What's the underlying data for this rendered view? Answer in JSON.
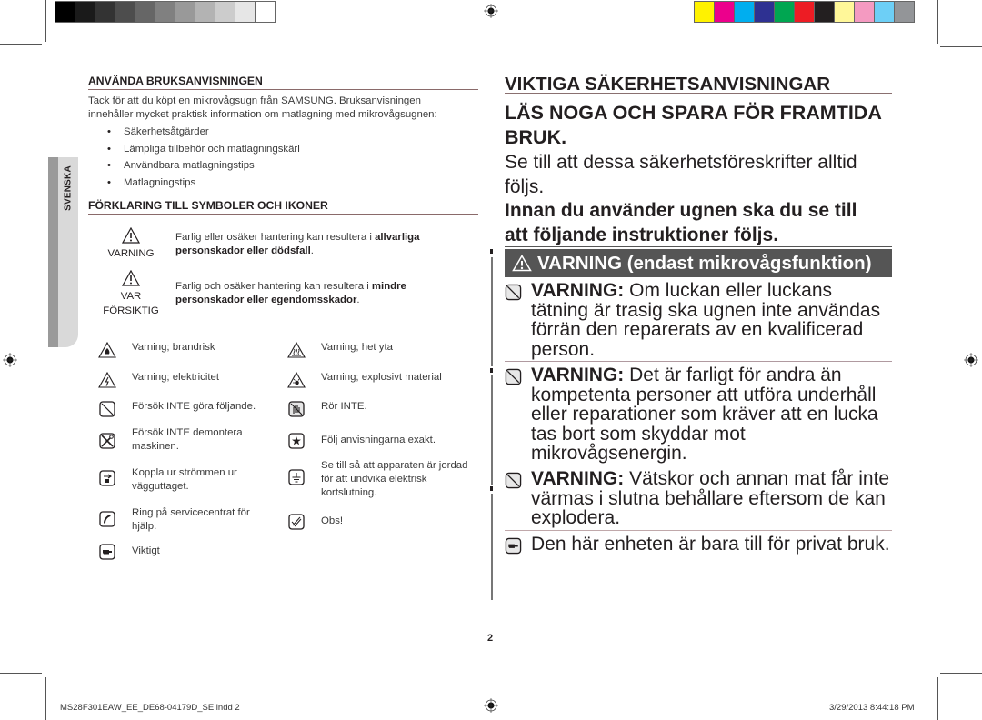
{
  "print_marks": {
    "grayscale_swatches": [
      "#000000",
      "#1a1a1a",
      "#333333",
      "#4d4d4d",
      "#666666",
      "#808080",
      "#999999",
      "#b3b3b3",
      "#cccccc",
      "#e6e6e6",
      "#ffffff"
    ],
    "color_swatches": [
      "#fff200",
      "#ec008c",
      "#00aeef",
      "#2e3192",
      "#00a651",
      "#ed1c24",
      "#231f20",
      "#fff799",
      "#f49ac1",
      "#6dcff6",
      "#939598"
    ]
  },
  "language_tab": "SVENSKA",
  "left": {
    "section1": {
      "heading": "ANVÄNDA BRUKSANVISNINGEN",
      "intro_line1": "Tack för att du köpt en mikrovågsugn från SAMSUNG. Bruksanvisningen",
      "intro_line2": "innehåller mycket praktisk information om matlagning med mikrovågsugnen:",
      "bullets": [
        "Säkerhetsåtgärder",
        "Lämpliga tillbehör och matlagningskärl",
        "Användbara matlagningstips",
        "Matlagningstips"
      ]
    },
    "section2": {
      "heading": "FÖRKLARING TILL SYMBOLER OCH IKONER",
      "warning": {
        "label": "VARNING",
        "text_prefix": "Farlig eller osäker hantering kan resultera i ",
        "bold1": "allvarliga",
        "bold2": "personskador eller dödsfall",
        "suffix": "."
      },
      "caution": {
        "label1": "VAR",
        "label2": "FÖRSIKTIG",
        "text_prefix": "Farlig och osäker hantering kan resultera i ",
        "bold1": "mindre",
        "bold2": "personskador eller egendomsskador",
        "suffix": "."
      },
      "symbols": [
        {
          "icon": "fire-hazard-icon",
          "text": "Varning; brandrisk"
        },
        {
          "icon": "hot-surface-icon",
          "text": "Varning; het yta"
        },
        {
          "icon": "electricity-icon",
          "text": "Varning; elektricitet"
        },
        {
          "icon": "explosive-icon",
          "text": "Varning; explosivt material"
        },
        {
          "icon": "prohibited-icon",
          "text": "Försök INTE göra följande."
        },
        {
          "icon": "do-not-touch-icon",
          "text": "Rör INTE."
        },
        {
          "icon": "no-disassemble-icon",
          "text": "Försök INTE demontera maskinen."
        },
        {
          "icon": "follow-instructions-icon",
          "text": "Följ anvisningarna exakt."
        },
        {
          "icon": "unplug-icon",
          "text": "Koppla ur strömmen ur vägguttaget."
        },
        {
          "icon": "ground-icon",
          "text": "Se till så att apparaten är jordad för att undvika elektrisk kortslutning."
        },
        {
          "icon": "phone-icon",
          "text": "Ring på servicecentrat för hjälp."
        },
        {
          "icon": "note-icon",
          "text": "Obs!"
        },
        {
          "icon": "important-hand-icon",
          "text": "Viktigt"
        }
      ]
    }
  },
  "right": {
    "title": "VIKTIGA SÄKERHETSANVISNINGAR",
    "subtitle_line1": "LÄS NOGA OCH SPARA FÖR FRAMTIDA",
    "subtitle_line2": "BRUK.",
    "note_line1": "Se till att dessa säkerhetsföreskrifter alltid",
    "note_line2": "följs.",
    "before_line1": "Innan du använder ugnen ska du se till",
    "before_line2": "att följande instruktioner följs.",
    "warning_bar": "VARNING (endast mikrovågsfunktion)",
    "items": [
      {
        "bold": "VARNING:",
        "text": " Om luckan eller luckans tätning är trasig ska ugnen inte användas förrän den reparerats av en kvalificerad person."
      },
      {
        "bold": "VARNING:",
        "text": " Det är farligt för andra än kompetenta personer att utföra underhåll eller reparationer som kräver att en lucka tas bort som skyddar mot mikrovågsenergin."
      },
      {
        "bold": "VARNING:",
        "text": " Vätskor och annan mat får inte värmas i slutna behållare eftersom de kan explodera."
      },
      {
        "bold": "",
        "text": "Den här enheten är bara till för privat bruk."
      }
    ]
  },
  "page_number": "2",
  "footer": {
    "file": "MS28F301EAW_EE_DE68-04179D_SE.indd   2",
    "timestamp": "3/29/2013   8:44:18 PM"
  }
}
